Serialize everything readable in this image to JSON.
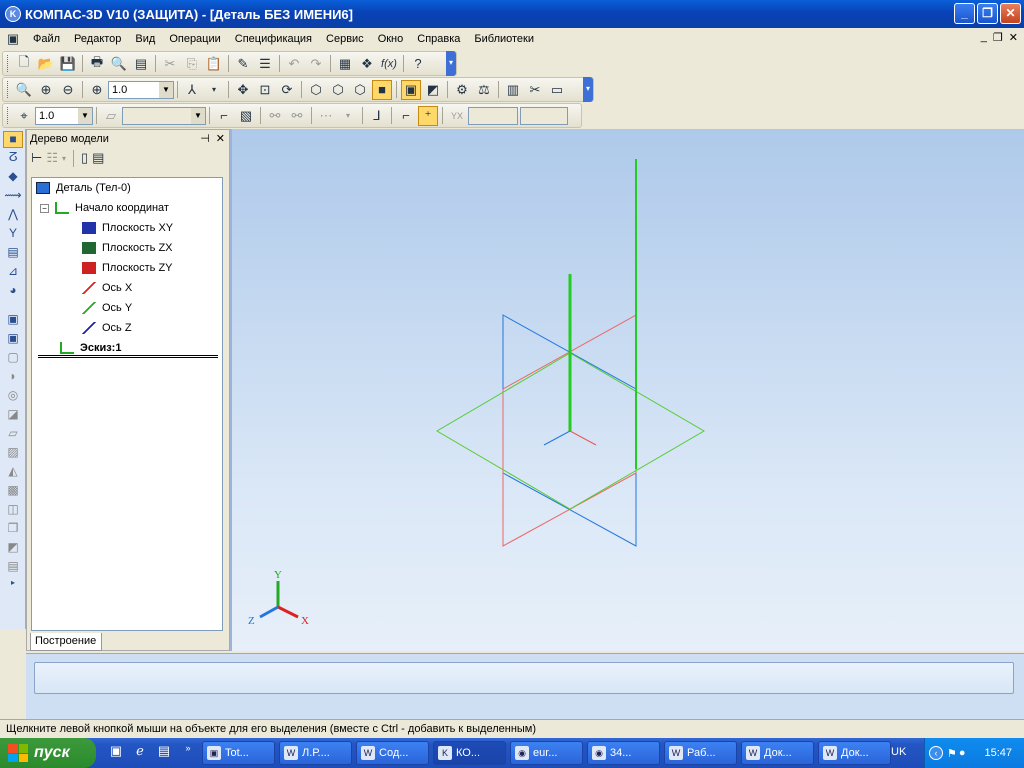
{
  "title": "КОМПАС-3D V10 (ЗАЩИТА) - [Деталь БЕЗ ИМЕНИ6]",
  "menu": [
    "Файл",
    "Редактор",
    "Вид",
    "Операции",
    "Спецификация",
    "Сервис",
    "Окно",
    "Справка",
    "Библиотеки"
  ],
  "toolbar": {
    "zoom_value": "1.0",
    "step_value": "1.0"
  },
  "tree": {
    "header": "Дерево модели",
    "root": "Деталь (Тел-0)",
    "origin": "Начало координат",
    "items": [
      "Плоскость XY",
      "Плоскость ZX",
      "Плоскость ZY",
      "Ось X",
      "Ось Y",
      "Ось Z"
    ],
    "sketch": "Эскиз:1",
    "tab": "Построение"
  },
  "axes_labels": {
    "x": "X",
    "y": "Y",
    "z": "Z"
  },
  "status": "Щелкните левой кнопкой мыши на объекте для его выделения (вместе с Ctrl - добавить к выделенным)",
  "taskbar": {
    "start": "пуск",
    "tasks": [
      "Tot...",
      "Л.Р....",
      "Сод...",
      "КО...",
      "eur...",
      "34...",
      "Раб...",
      "Док...",
      "Док..."
    ],
    "lang": "UK",
    "clock": "15:47"
  },
  "colors": {
    "plane_xy": "#2277dd",
    "plane_zx": "#55cc33",
    "plane_zy": "#ee6666",
    "accent_taskbar": "#245edb"
  }
}
